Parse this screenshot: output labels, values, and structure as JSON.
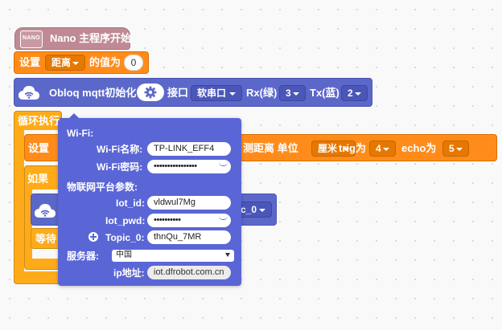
{
  "hat": {
    "nano_label": "NANO",
    "title": "Nano 主程序开始"
  },
  "set_block": {
    "prefix": "设置",
    "variable": "距离",
    "suffix": "的值为",
    "value": "0"
  },
  "obloq_block": {
    "title": "Obloq mqtt初始化",
    "port_label": "接口",
    "port_value": "软串口",
    "rx_label": "Rx(绿)",
    "rx_value": "3",
    "tx_label": "Tx(蓝)",
    "tx_value": "2"
  },
  "loop_block": {
    "label": "循环执行"
  },
  "inner_set_block": {
    "prefix": "设置",
    "measure_suffix": "测距离 单位",
    "unit_value": "厘米",
    "trig_label": "trig为",
    "trig_value": "4",
    "echo_label": "echo为",
    "echo_value": "5"
  },
  "if_block": {
    "label": "如果"
  },
  "topic_fragment": {
    "text": "c_0"
  },
  "wait_block": {
    "label": "等待"
  },
  "popup": {
    "wifi_header": "Wi-Fi:",
    "wifi_name_label": "Wi-Fi名称:",
    "wifi_name_value": "TP-LINK_EFF4",
    "wifi_pwd_label": "Wi-Fi密码:",
    "wifi_pwd_value": "••••••••••••••••",
    "iot_header": "物联网平台参数:",
    "iot_id_label": "Iot_id:",
    "iot_id_value": "vldwul7Mg",
    "iot_pwd_label": "Iot_pwd:",
    "iot_pwd_value": "••••••••••",
    "add_icon": "plus-circle-icon",
    "topic0_label": "Topic_0:",
    "topic0_value": "thnQu_7MR",
    "server_label": "服务器:",
    "server_value": "中国",
    "ip_label": "ip地址:",
    "ip_value": "iot.dfrobot.com.cn"
  },
  "colors": {
    "control_orange": "#FF8C1A",
    "obloq_purple": "#5C68C9",
    "hat_pink": "#BF8A94",
    "popup_bg": "#5A66D6"
  }
}
